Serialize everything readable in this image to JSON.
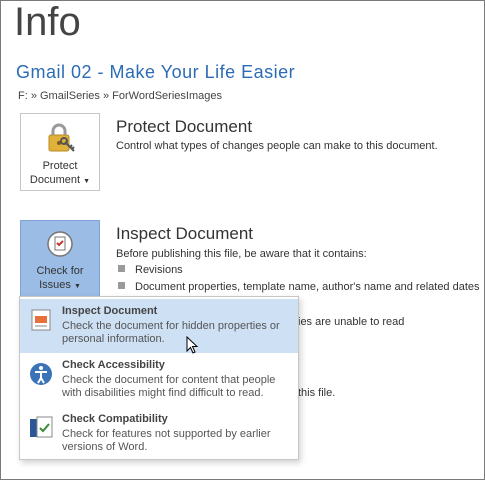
{
  "page_title": "Info",
  "document": {
    "title": "Gmail 02 - Make Your Life Easier",
    "path": "F: » GmailSeries » ForWordSeriesImages"
  },
  "protect": {
    "button_line1": "Protect",
    "button_line2": "Document",
    "heading": "Protect Document",
    "description": "Control what types of changes people can make to this document."
  },
  "inspect": {
    "button_line1": "Check for",
    "button_line2": "Issues",
    "heading": "Inspect Document",
    "description": "Before publishing this file, be aware that it contains:",
    "bullets": [
      "Revisions",
      "Document properties, template name, author's name and related dates"
    ],
    "partial_line": "ies are unable to read",
    "partial_line2": "this file."
  },
  "menu": {
    "items": [
      {
        "title": "Inspect Document",
        "desc": "Check the document for hidden properties or personal information."
      },
      {
        "title": "Check Accessibility",
        "desc": "Check the document for content that people with disabilities might find difficult to read."
      },
      {
        "title": "Check Compatibility",
        "desc": "Check for features not supported by earlier versions of Word."
      }
    ]
  },
  "colors": {
    "accent": "#2b6cb5",
    "highlight": "#cde0f4",
    "active_tile": "#9bbce4"
  }
}
